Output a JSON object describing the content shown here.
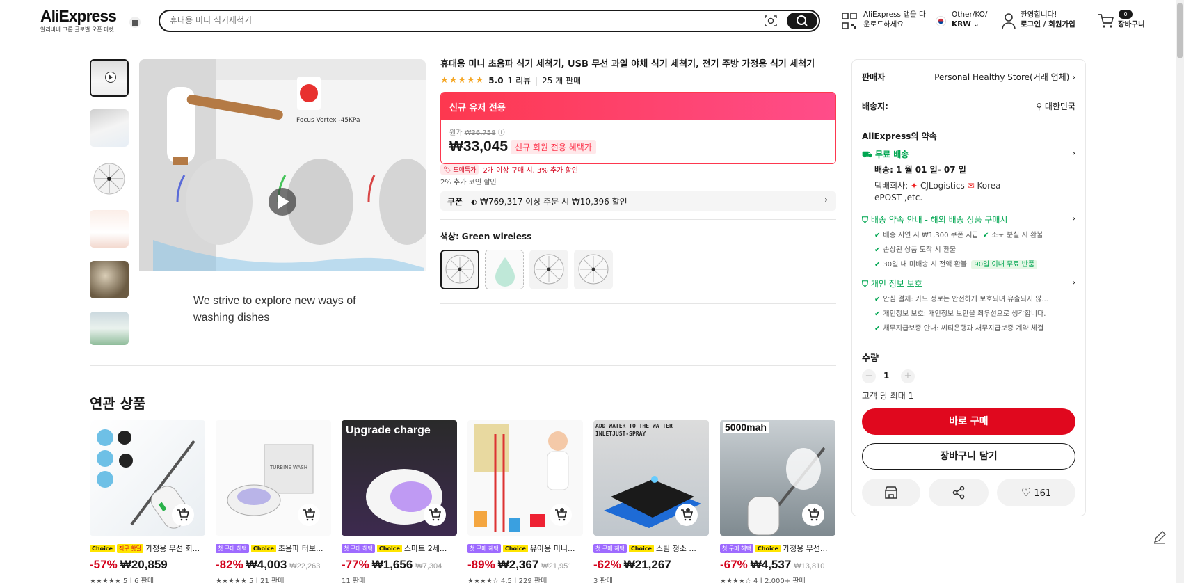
{
  "header": {
    "logo": "AliExpress",
    "logo_tagline": "알리바바 그룹 글로벌 오픈 마켓",
    "search_placeholder": "휴대용 미니 식기세척기",
    "app_line1": "AliExpress 앱을 다",
    "app_line2": "운로드하세요",
    "region_line1": "Other/KO/",
    "region_line2": "KRW",
    "account_line1": "환영합니다!",
    "account_line2": "로그인 / 회원가입",
    "cart_count": "0",
    "cart_label": "장바구니"
  },
  "gallery": {
    "image_caption_line1": "We strive to explore new ways of",
    "image_caption_line2": "washing dishes",
    "brand_text": "Focus Vortex -45KPa"
  },
  "product": {
    "title": "휴대용 미니 초음파 식기 세척기, USB 무선 과일 야채 식기 세척기, 전기 주방 가정용 식기 세척기",
    "stars": "★★★★★",
    "rating": "5.0",
    "reviews": "1 리뷰",
    "sold": "25 개 판매",
    "promo_banner": "신규 유저 전용",
    "orig_label": "원가",
    "orig_price": "₩36,758",
    "price": "₩33,045",
    "member_tag": "신규 회원 전용 혜택가",
    "deal_tag": "도매특가",
    "deal_text": "2개 이상 구매 시, 3% 추가 할인",
    "coin_text": "2% 추가 코인 할인",
    "coupon_label": "쿠폰",
    "coupon_text": "₩769,317 이상 주문 시 ₩10,396 할인",
    "color_label": "색상:",
    "color_value": "Green wireless"
  },
  "panel": {
    "seller_label": "판매자",
    "seller_name": "Personal Healthy Store(거래 업체)",
    "ship_label": "배송지:",
    "ship_value": "대한민국",
    "promise_title": "AliExpress의 약속",
    "free_ship": "무료 배송",
    "delivery": "배송: 1 월 01 일- 07 일",
    "carrier_label": "택배회사:",
    "carrier1": "CJLogistics",
    "carrier2": "Korea",
    "carrier3": "ePOST ,etc.",
    "guide_title": "배송 약속 안내 - 해외 배송 상품 구매시",
    "guide_1": "배송 지연 시 ₩1,300 쿠폰 지급",
    "guide_2": "소포 분실 시 환불",
    "guide_3": "손상된 상품 도착 시 환불",
    "guide_4": "30일 내 미배송 시 전액 환불",
    "guide_4_badge": "90일 이내 무료 반품",
    "privacy_title": "개인 정보 보호",
    "privacy_1": "안심 결제: 카드 정보는 안전하게 보호되며 유출되지 않...",
    "privacy_2": "개인정보 보호: 개인정보 보안을 최우선으로 생각합니다.",
    "privacy_3": "채무지급보증 안내: 씨티은행과 채무지급보증 계약 체결",
    "qty_label": "수량",
    "qty_value": "1",
    "qty_limit": "고객 당 최대 1",
    "buy_now": "바로 구매",
    "add_cart": "장바구니 담기",
    "wishlist_count": "161"
  },
  "related": {
    "title": "연관 상품",
    "items": [
      {
        "chips": [
          "Choice",
          "직구 핫딜"
        ],
        "name": "가정용 무선 회...",
        "discount": "-57%",
        "price": "₩20,859",
        "old": "",
        "stars": "★★★★★",
        "meta": "5 | 6 판매",
        "img_text": ""
      },
      {
        "chips": [
          "첫 구매 혜택",
          "Choice"
        ],
        "name": "초음파 터보...",
        "discount": "-82%",
        "price": "₩4,003",
        "old": "₩22,263",
        "stars": "★★★★★",
        "meta": "5 | 21 판매",
        "img_text": ""
      },
      {
        "chips": [
          "첫 구매 혜택",
          "Choice"
        ],
        "name": "스마트 2세...",
        "discount": "-77%",
        "price": "₩1,656",
        "old": "₩7,304",
        "stars": "",
        "meta": "11 판매",
        "img_text": "Upgrade charge"
      },
      {
        "chips": [
          "첫 구매 혜택",
          "Choice"
        ],
        "name": "유아용 미니...",
        "discount": "-89%",
        "price": "₩2,367",
        "old": "₩21,951",
        "stars": "★★★★☆",
        "meta": "4.5 | 229 판매",
        "img_text": ""
      },
      {
        "chips": [
          "첫 구매 혜택",
          "Choice"
        ],
        "name": "스팀 청소 ...",
        "discount": "-62%",
        "price": "₩21,267",
        "old": "",
        "stars": "",
        "meta": "3 판매",
        "img_text": "ADD WATER TO THE WA TER INLETJUST-SPRAY"
      },
      {
        "chips": [
          "첫 구매 혜택",
          "Choice"
        ],
        "name": "가정용 무선...",
        "discount": "-67%",
        "price": "₩4,537",
        "old": "₩13,810",
        "stars": "★★★★☆",
        "meta": "4 | 2,000+ 판매",
        "img_text": "5000mah"
      }
    ]
  },
  "colors": {
    "accent": "#fd384f",
    "buy": "#d3031c",
    "green": "#00a651"
  }
}
